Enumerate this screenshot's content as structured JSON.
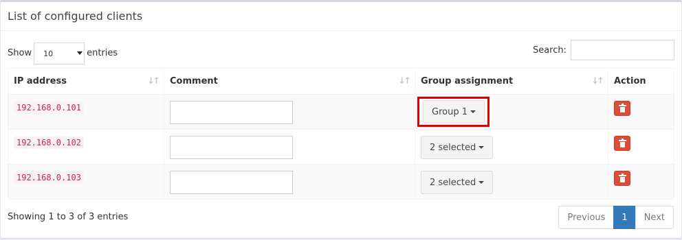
{
  "box": {
    "title": "List of configured clients"
  },
  "length": {
    "show_label": "Show",
    "value": "10",
    "entries_label": "entries"
  },
  "search": {
    "label": "Search:",
    "value": ""
  },
  "table": {
    "headers": [
      "IP address",
      "Comment",
      "Group assignment",
      "Action"
    ],
    "rows": [
      {
        "ip": "192.168.0.101",
        "comment": "",
        "group": "Group 1"
      },
      {
        "ip": "192.168.0.102",
        "comment": "",
        "group": "2 selected"
      },
      {
        "ip": "192.168.0.103",
        "comment": "",
        "group": "2 selected"
      }
    ]
  },
  "footer": {
    "info": "Showing 1 to 3 of 3 entries"
  },
  "pagination": {
    "previous": "Previous",
    "current": "1",
    "next": "Next"
  },
  "colors": {
    "delete": "#dd4b39",
    "ip": "#c7254e",
    "active_page": "#337ab7",
    "highlight": "#e00000"
  },
  "icons": {
    "sort": "sort-icon",
    "caret": "caret-down-icon",
    "delete": "trash-icon"
  }
}
